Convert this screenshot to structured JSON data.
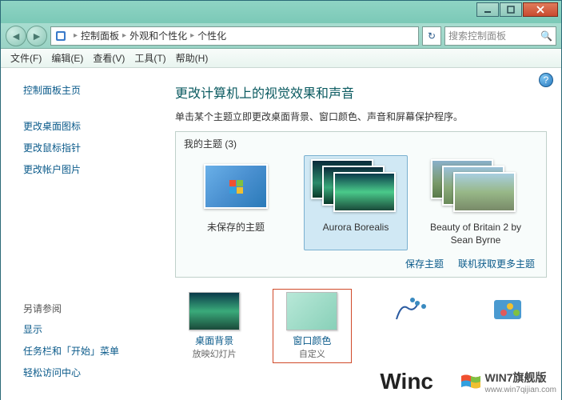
{
  "window_controls": {
    "min": "minimize-icon",
    "max": "maximize-icon",
    "close": "close-icon"
  },
  "breadcrumb": {
    "items": [
      "控制面板",
      "外观和个性化",
      "个性化"
    ]
  },
  "search": {
    "placeholder": "搜索控制面板"
  },
  "menubar": {
    "file": "文件(F)",
    "edit": "编辑(E)",
    "view": "查看(V)",
    "tools": "工具(T)",
    "help": "帮助(H)"
  },
  "sidebar": {
    "home": "控制面板主页",
    "links": [
      "更改桌面图标",
      "更改鼠标指针",
      "更改帐户图片"
    ],
    "also_heading": "另请参阅",
    "also_links": [
      "显示",
      "任务栏和「开始」菜单",
      "轻松访问中心"
    ]
  },
  "main": {
    "title": "更改计算机上的视觉效果和声音",
    "desc": "单击某个主题立即更改桌面背景、窗口颜色、声音和屏幕保护程序。",
    "themes_heading": "我的主题 (3)",
    "themes": [
      {
        "label": "未保存的主题",
        "selected": false,
        "type": "single"
      },
      {
        "label": "Aurora Borealis",
        "selected": true,
        "type": "stack-green"
      },
      {
        "label": "Beauty of Britain 2 by Sean Byrne",
        "selected": false,
        "type": "stack-photo"
      }
    ],
    "save_theme": "保存主题",
    "more_themes": "联机获取更多主题",
    "bottom": [
      {
        "label": "桌面背景",
        "sub": "放映幻灯片",
        "highlight": false,
        "thumb": "aurora"
      },
      {
        "label": "窗口颜色",
        "sub": "自定义",
        "highlight": true,
        "thumb": "color"
      }
    ]
  },
  "watermark1": "Winc",
  "watermark2_text": "WIN7旗舰版",
  "watermark2_url": "www.win7qijian.com"
}
